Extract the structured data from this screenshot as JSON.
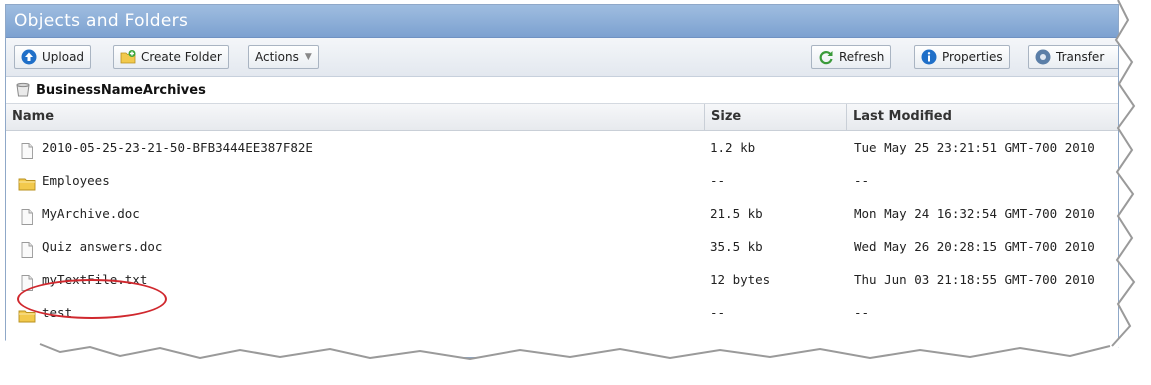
{
  "window": {
    "title": "Objects and Folders"
  },
  "toolbar": {
    "upload_label": "Upload",
    "create_folder_label": "Create Folder",
    "actions_label": "Actions",
    "refresh_label": "Refresh",
    "properties_label": "Properties",
    "transfer_label": "Transfer"
  },
  "breadcrumb": {
    "bucket_name": "BusinessNameArchives"
  },
  "table": {
    "headers": {
      "name": "Name",
      "size": "Size",
      "last_modified": "Last Modified"
    },
    "rows": [
      {
        "type": "file",
        "icon": "file-icon",
        "name": "2010-05-25-23-21-50-BFB3444EE387F82E",
        "size": "1.2 kb",
        "modified": "Tue May 25 23:21:51 GMT-700 2010"
      },
      {
        "type": "folder",
        "icon": "folder-icon",
        "name": "Employees",
        "size": "--",
        "modified": "--"
      },
      {
        "type": "file",
        "icon": "file-icon",
        "name": "MyArchive.doc",
        "size": "21.5 kb",
        "modified": "Mon May 24 16:32:54 GMT-700 2010"
      },
      {
        "type": "file",
        "icon": "file-icon",
        "name": "Quiz answers.doc",
        "size": "35.5 kb",
        "modified": "Wed May 26 20:28:15 GMT-700 2010"
      },
      {
        "type": "file",
        "icon": "file-icon",
        "name": "myTextFile.txt",
        "size": "12 bytes",
        "modified": "Thu Jun 03 21:18:55 GMT-700 2010",
        "highlighted": true
      },
      {
        "type": "folder",
        "icon": "folder-icon",
        "name": "test",
        "size": "--",
        "modified": "--"
      }
    ]
  },
  "colors": {
    "title_bar": "#8aaed8",
    "highlight_ring": "#d0282e",
    "folder": "#f2c94c"
  }
}
